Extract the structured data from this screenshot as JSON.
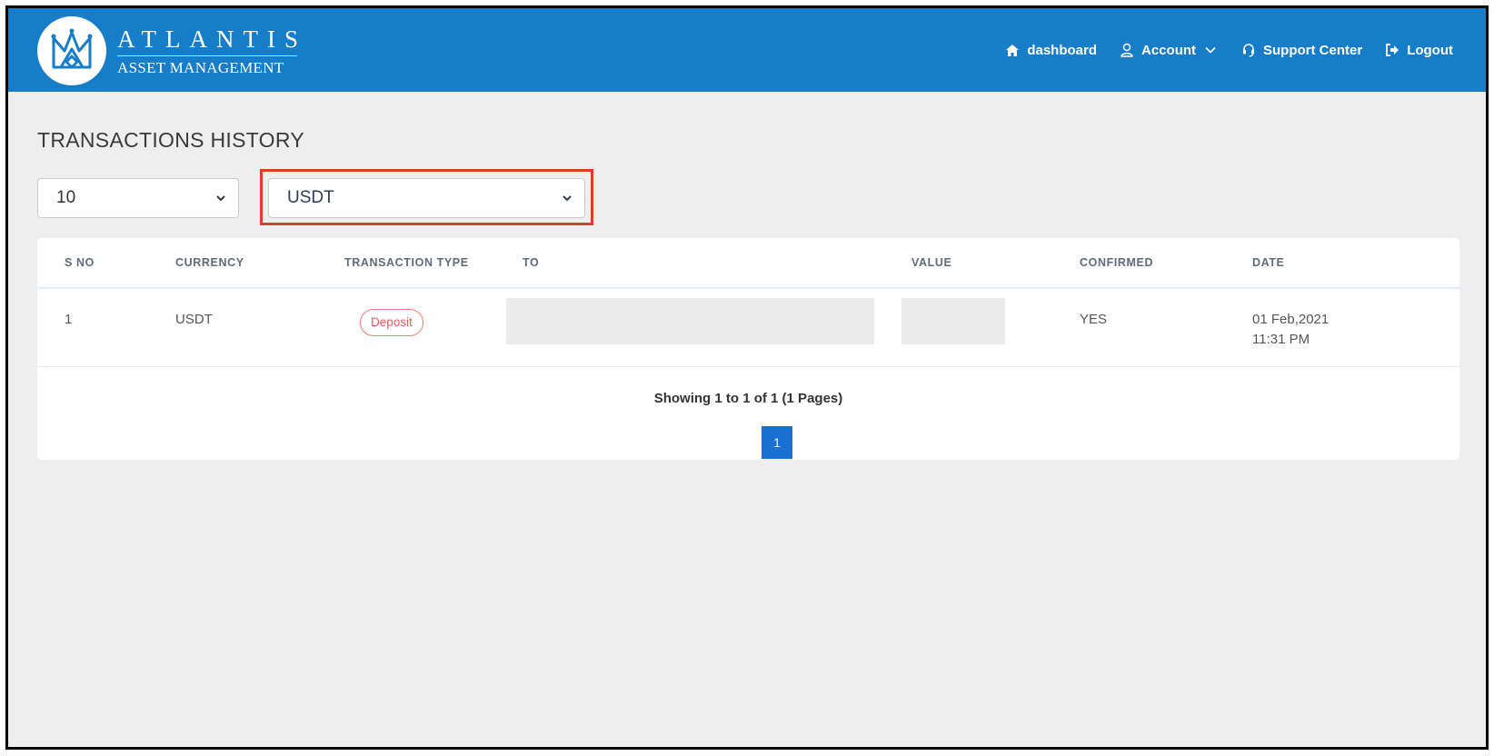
{
  "brand": {
    "name_line1": "ATLANTIS",
    "name_line2": "ASSET MANAGEMENT"
  },
  "nav": {
    "items": [
      {
        "label": "dashboard",
        "icon": "home-icon"
      },
      {
        "label": "Account",
        "icon": "user-icon",
        "has_dropdown": true
      },
      {
        "label": "Support Center",
        "icon": "headset-icon"
      },
      {
        "label": "Logout",
        "icon": "logout-icon"
      }
    ]
  },
  "page": {
    "title": "TRANSACTIONS HISTORY"
  },
  "filters": {
    "page_size": "10",
    "currency": "USDT"
  },
  "table": {
    "columns": [
      "S NO",
      "CURRENCY",
      "TRANSACTION TYPE",
      "TO",
      "VALUE",
      "CONFIRMED",
      "DATE"
    ],
    "rows": [
      {
        "sno": "1",
        "currency": "USDT",
        "type": "Deposit",
        "to": "",
        "value": "",
        "confirmed": "YES",
        "date": "01 Feb,2021",
        "time": "11:31 PM"
      }
    ]
  },
  "pagination": {
    "summary": "Showing 1 to 1 of 1 (1 Pages)",
    "current_page": "1"
  },
  "colors": {
    "header_bg": "#177dc9",
    "accent_blue": "#1a6fd1",
    "badge_red": "#ef5a5a",
    "highlight_red": "#e23b2b",
    "page_bg": "#eeeeee"
  }
}
